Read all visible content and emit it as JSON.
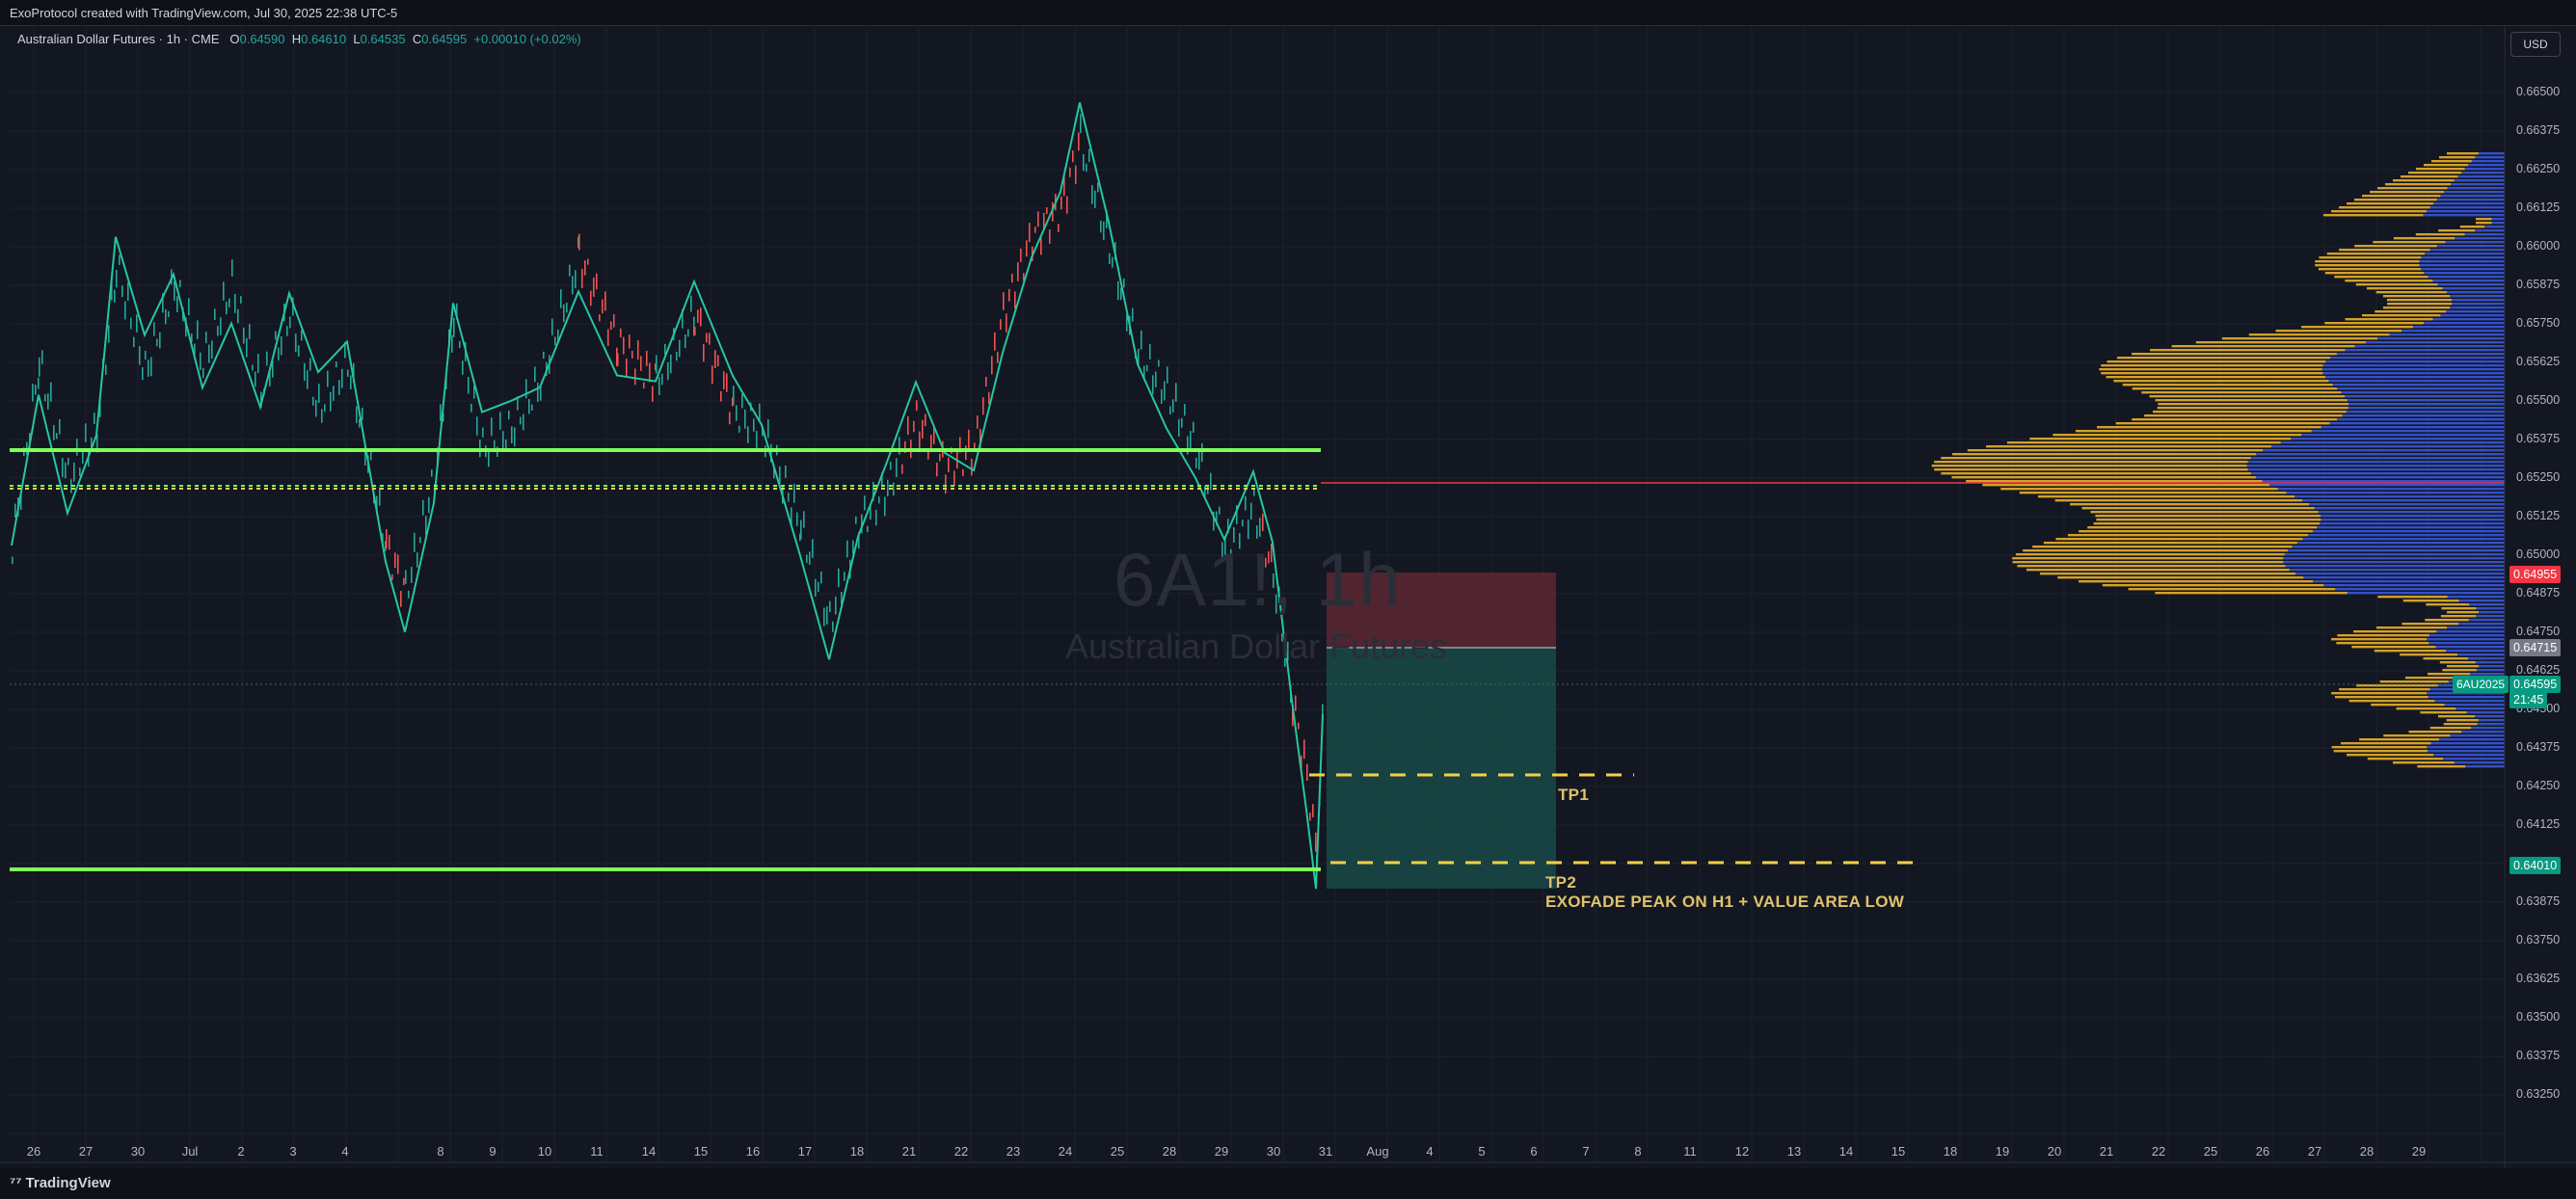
{
  "header": {
    "credit": "ExoProtocol created with TradingView.com, Jul 30, 2025 22:38 UTC-5"
  },
  "legend": {
    "symbol": "Australian Dollar Futures · 1h · CME",
    "o_label": "O",
    "o_value": "0.64590",
    "h_label": "H",
    "h_value": "0.64610",
    "l_label": "L",
    "l_value": "0.64535",
    "c_label": "C",
    "c_value": "0.64595",
    "change": "+0.00010 (+0.02%)"
  },
  "currency": "USD",
  "watermark": {
    "ticker": "6A1!, 1h",
    "name": "Australian Dollar Futures"
  },
  "price_axis": {
    "labels": [
      "0.66500",
      "0.66375",
      "0.66250",
      "0.66125",
      "0.66000",
      "0.65875",
      "0.65750",
      "0.65625",
      "0.65500",
      "0.65375",
      "0.65250",
      "0.65125",
      "0.65000",
      "0.64875",
      "0.64750",
      "0.64625",
      "0.64500",
      "0.64375",
      "0.64250",
      "0.64125",
      "0.64000",
      "0.63875",
      "0.63750",
      "0.63625",
      "0.63500",
      "0.63375",
      "0.63250"
    ],
    "badges": {
      "stop": "0.64955",
      "entry": "0.64715",
      "last": "0.64595",
      "countdown": "21:45",
      "target": "0.64010"
    },
    "ticker_badge": "6AU2025"
  },
  "time_axis": {
    "labels": [
      "26",
      "27",
      "30",
      "Jul",
      "2",
      "3",
      "4",
      "8",
      "9",
      "10",
      "11",
      "14",
      "15",
      "16",
      "17",
      "18",
      "21",
      "22",
      "23",
      "24",
      "25",
      "28",
      "29",
      "30",
      "31",
      "Aug",
      "4",
      "5",
      "6",
      "7",
      "8",
      "11",
      "12",
      "13",
      "14",
      "15",
      "18",
      "19",
      "20",
      "21",
      "22",
      "25",
      "26",
      "27",
      "28",
      "29"
    ]
  },
  "annotations": {
    "tp1": "TP1",
    "tp2": "TP2",
    "tp2_note": "EXOFADE PEAK ON H1 + VALUE AREA LOW"
  },
  "colors": {
    "background": "#131722",
    "up": "#26a69a",
    "down": "#ef5350",
    "envelope": "#26c6a0",
    "level_line": "#7dff5a",
    "poc_line": "#f23645",
    "volume_profile_up": "#d4a12a",
    "volume_profile_down": "#3450c8",
    "tp_line": "#f5d04a"
  },
  "footer": {
    "brand": "TradingView"
  }
}
